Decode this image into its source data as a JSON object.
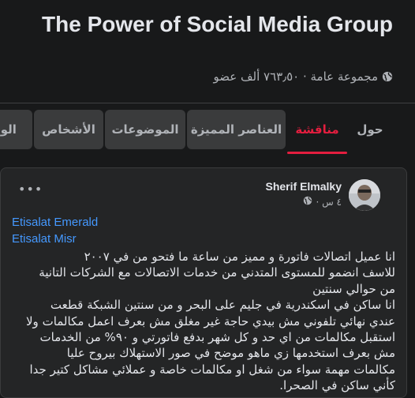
{
  "group": {
    "title": "The Power of Social Media Group",
    "meta": "مجموعة عامة · ٧٦٣٫٥٠ ألف عضو"
  },
  "tabs": [
    {
      "label": "حول"
    },
    {
      "label": "مناقشة"
    },
    {
      "label": "العناصر المميزة"
    },
    {
      "label": "الموضوعات"
    },
    {
      "label": "الأشخاص"
    },
    {
      "label": "الوس"
    }
  ],
  "post": {
    "author": "Sherif Elmalky",
    "time": "٤ س ·",
    "tags": [
      "Etisalat Emerald",
      "Etisalat Misr"
    ],
    "lines": [
      "انا عميل اتصالات فاتورة و مميز من ساعة ما فتحو من في ٢٠٠٧",
      "للاسف انضمو للمستوى المتدني من خدمات الاتصالات مع الشركات التانية من حوالي سنتين",
      "انا ساكن في اسكندرية في جليم على البحر و من سنتين الشبكة قطعت عندي نهائي تلفوني مش بيدي حاجة غير مغلق مش بعرف اعمل مكالمات ولا استقبل مكالمات من اي حد و كل شهر بدفع فاتورتي و ٩٠% من الخدمات مش بعرف استخدمها زي ماهو موضح في صور الاستهلاك بيروح عليا مكالمات مهمة سواء من شغل او مكالمات خاصة و عملائي مشاكل كتير جدا كأني ساكن في الصحرا."
    ]
  }
}
